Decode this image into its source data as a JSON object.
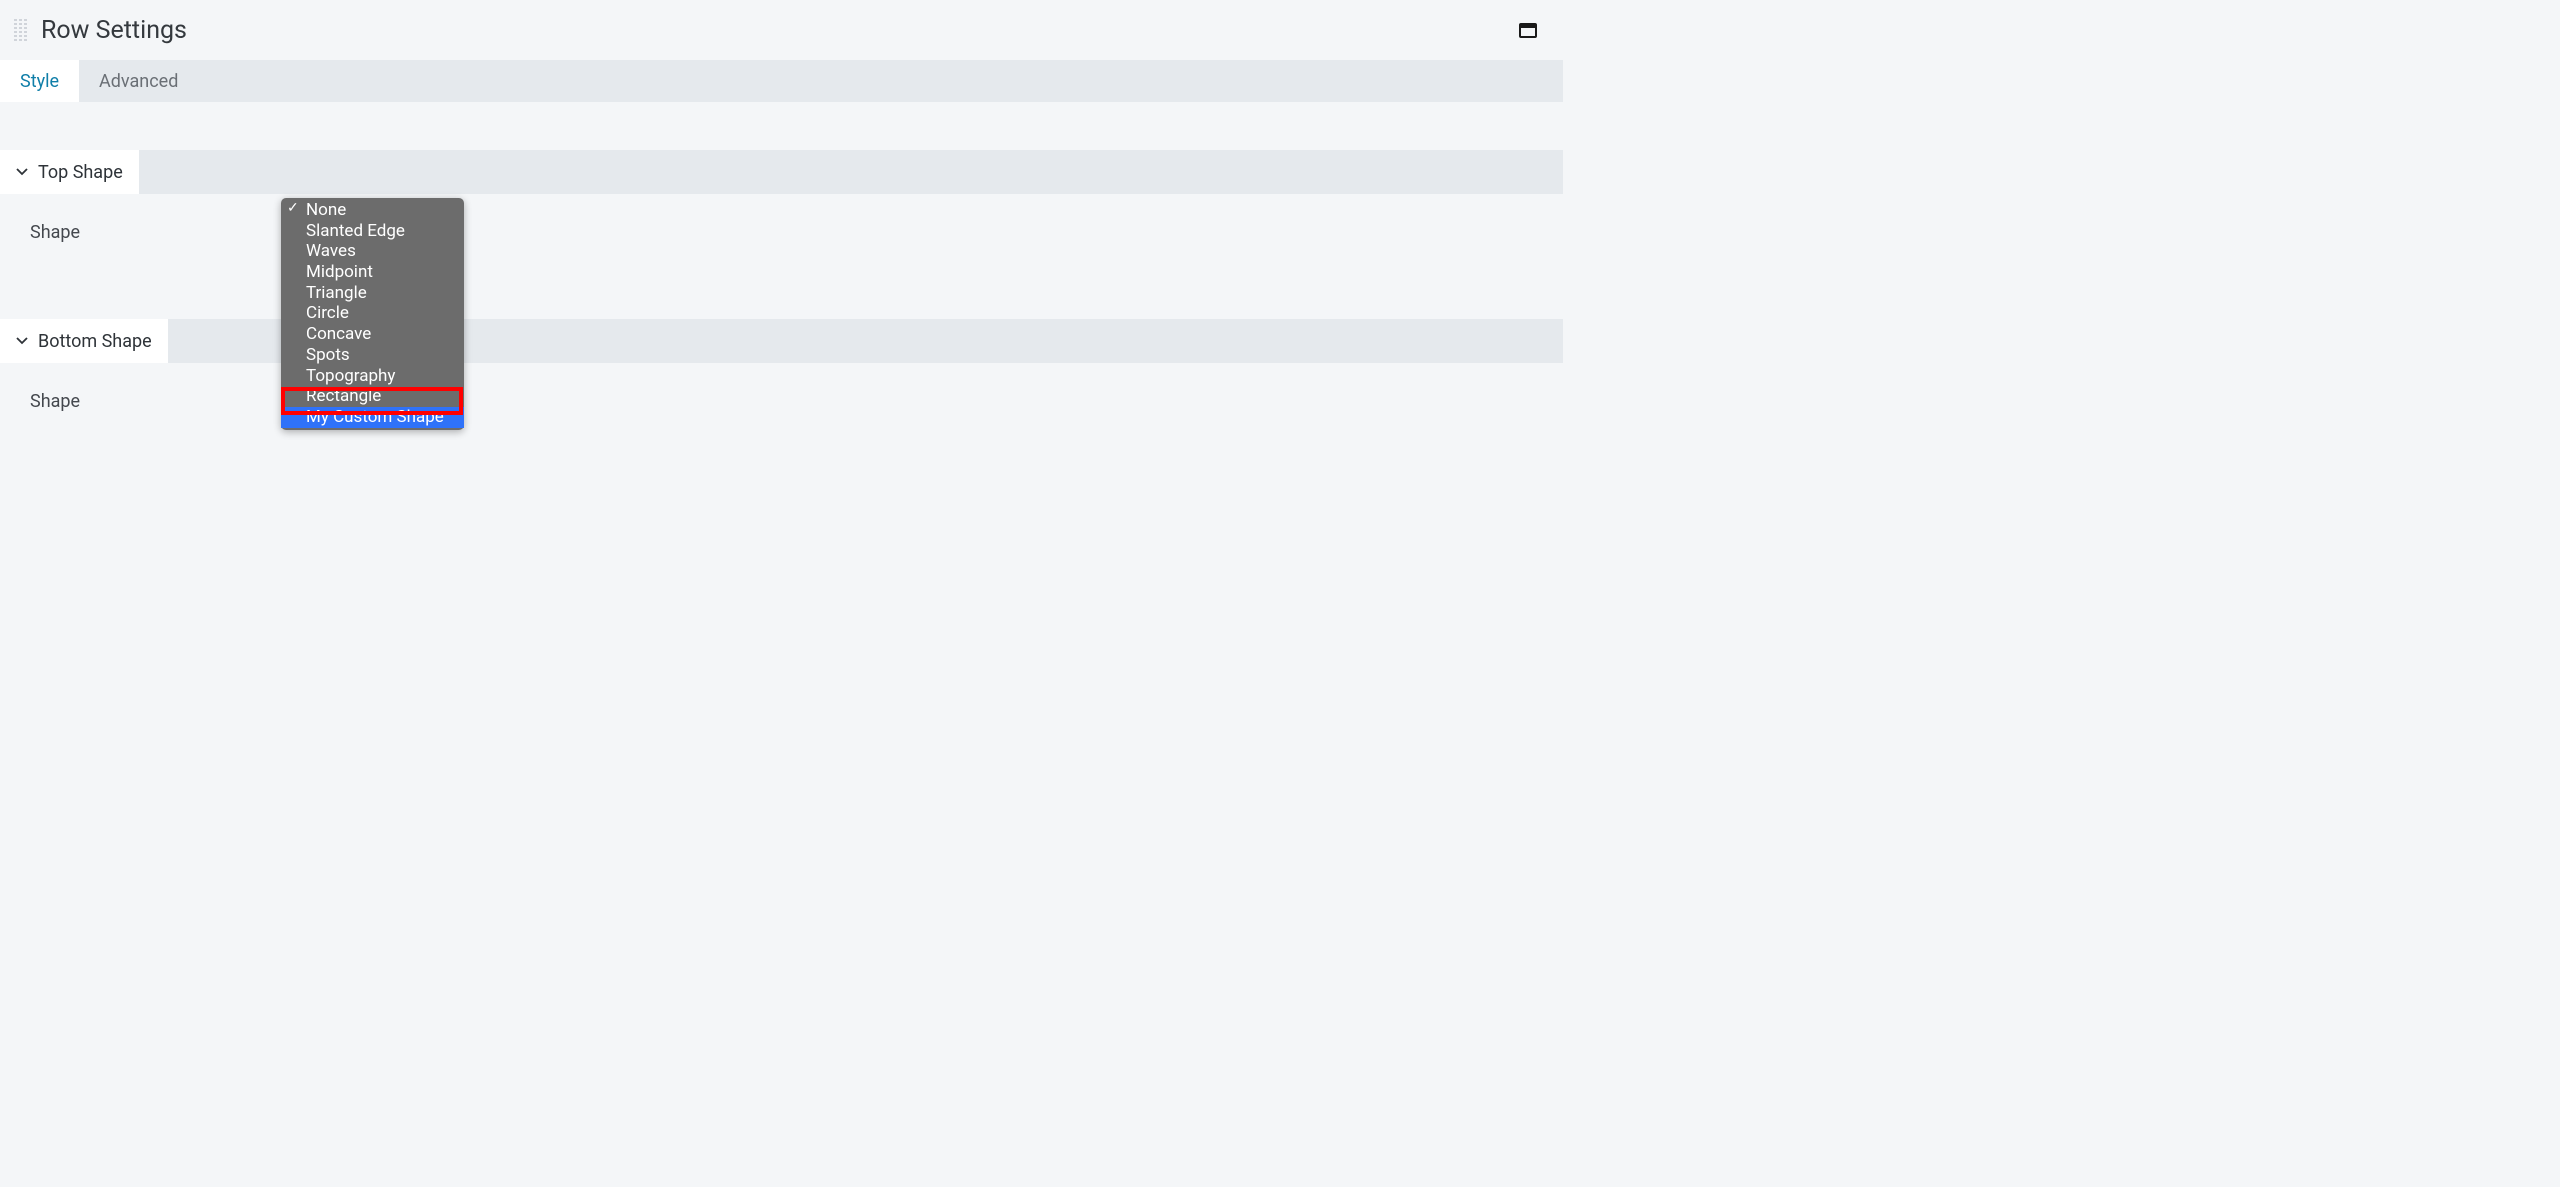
{
  "header": {
    "title": "Row Settings"
  },
  "tabs": [
    {
      "label": "Style",
      "active": true
    },
    {
      "label": "Advanced",
      "active": false
    }
  ],
  "sections": {
    "top": {
      "title": "Top Shape",
      "fieldLabel": "Shape"
    },
    "bottom": {
      "title": "Bottom Shape",
      "fieldLabel": "Shape"
    }
  },
  "dropdown": {
    "options": [
      {
        "label": "None",
        "checked": true,
        "highlighted": false
      },
      {
        "label": "Slanted Edge",
        "checked": false,
        "highlighted": false
      },
      {
        "label": "Waves",
        "checked": false,
        "highlighted": false
      },
      {
        "label": "Midpoint",
        "checked": false,
        "highlighted": false
      },
      {
        "label": "Triangle",
        "checked": false,
        "highlighted": false
      },
      {
        "label": "Circle",
        "checked": false,
        "highlighted": false
      },
      {
        "label": "Concave",
        "checked": false,
        "highlighted": false
      },
      {
        "label": "Spots",
        "checked": false,
        "highlighted": false
      },
      {
        "label": "Topography",
        "checked": false,
        "highlighted": false
      },
      {
        "label": "Rectangle",
        "checked": false,
        "highlighted": false
      },
      {
        "label": "My Custom Shape",
        "checked": false,
        "highlighted": true
      }
    ]
  }
}
